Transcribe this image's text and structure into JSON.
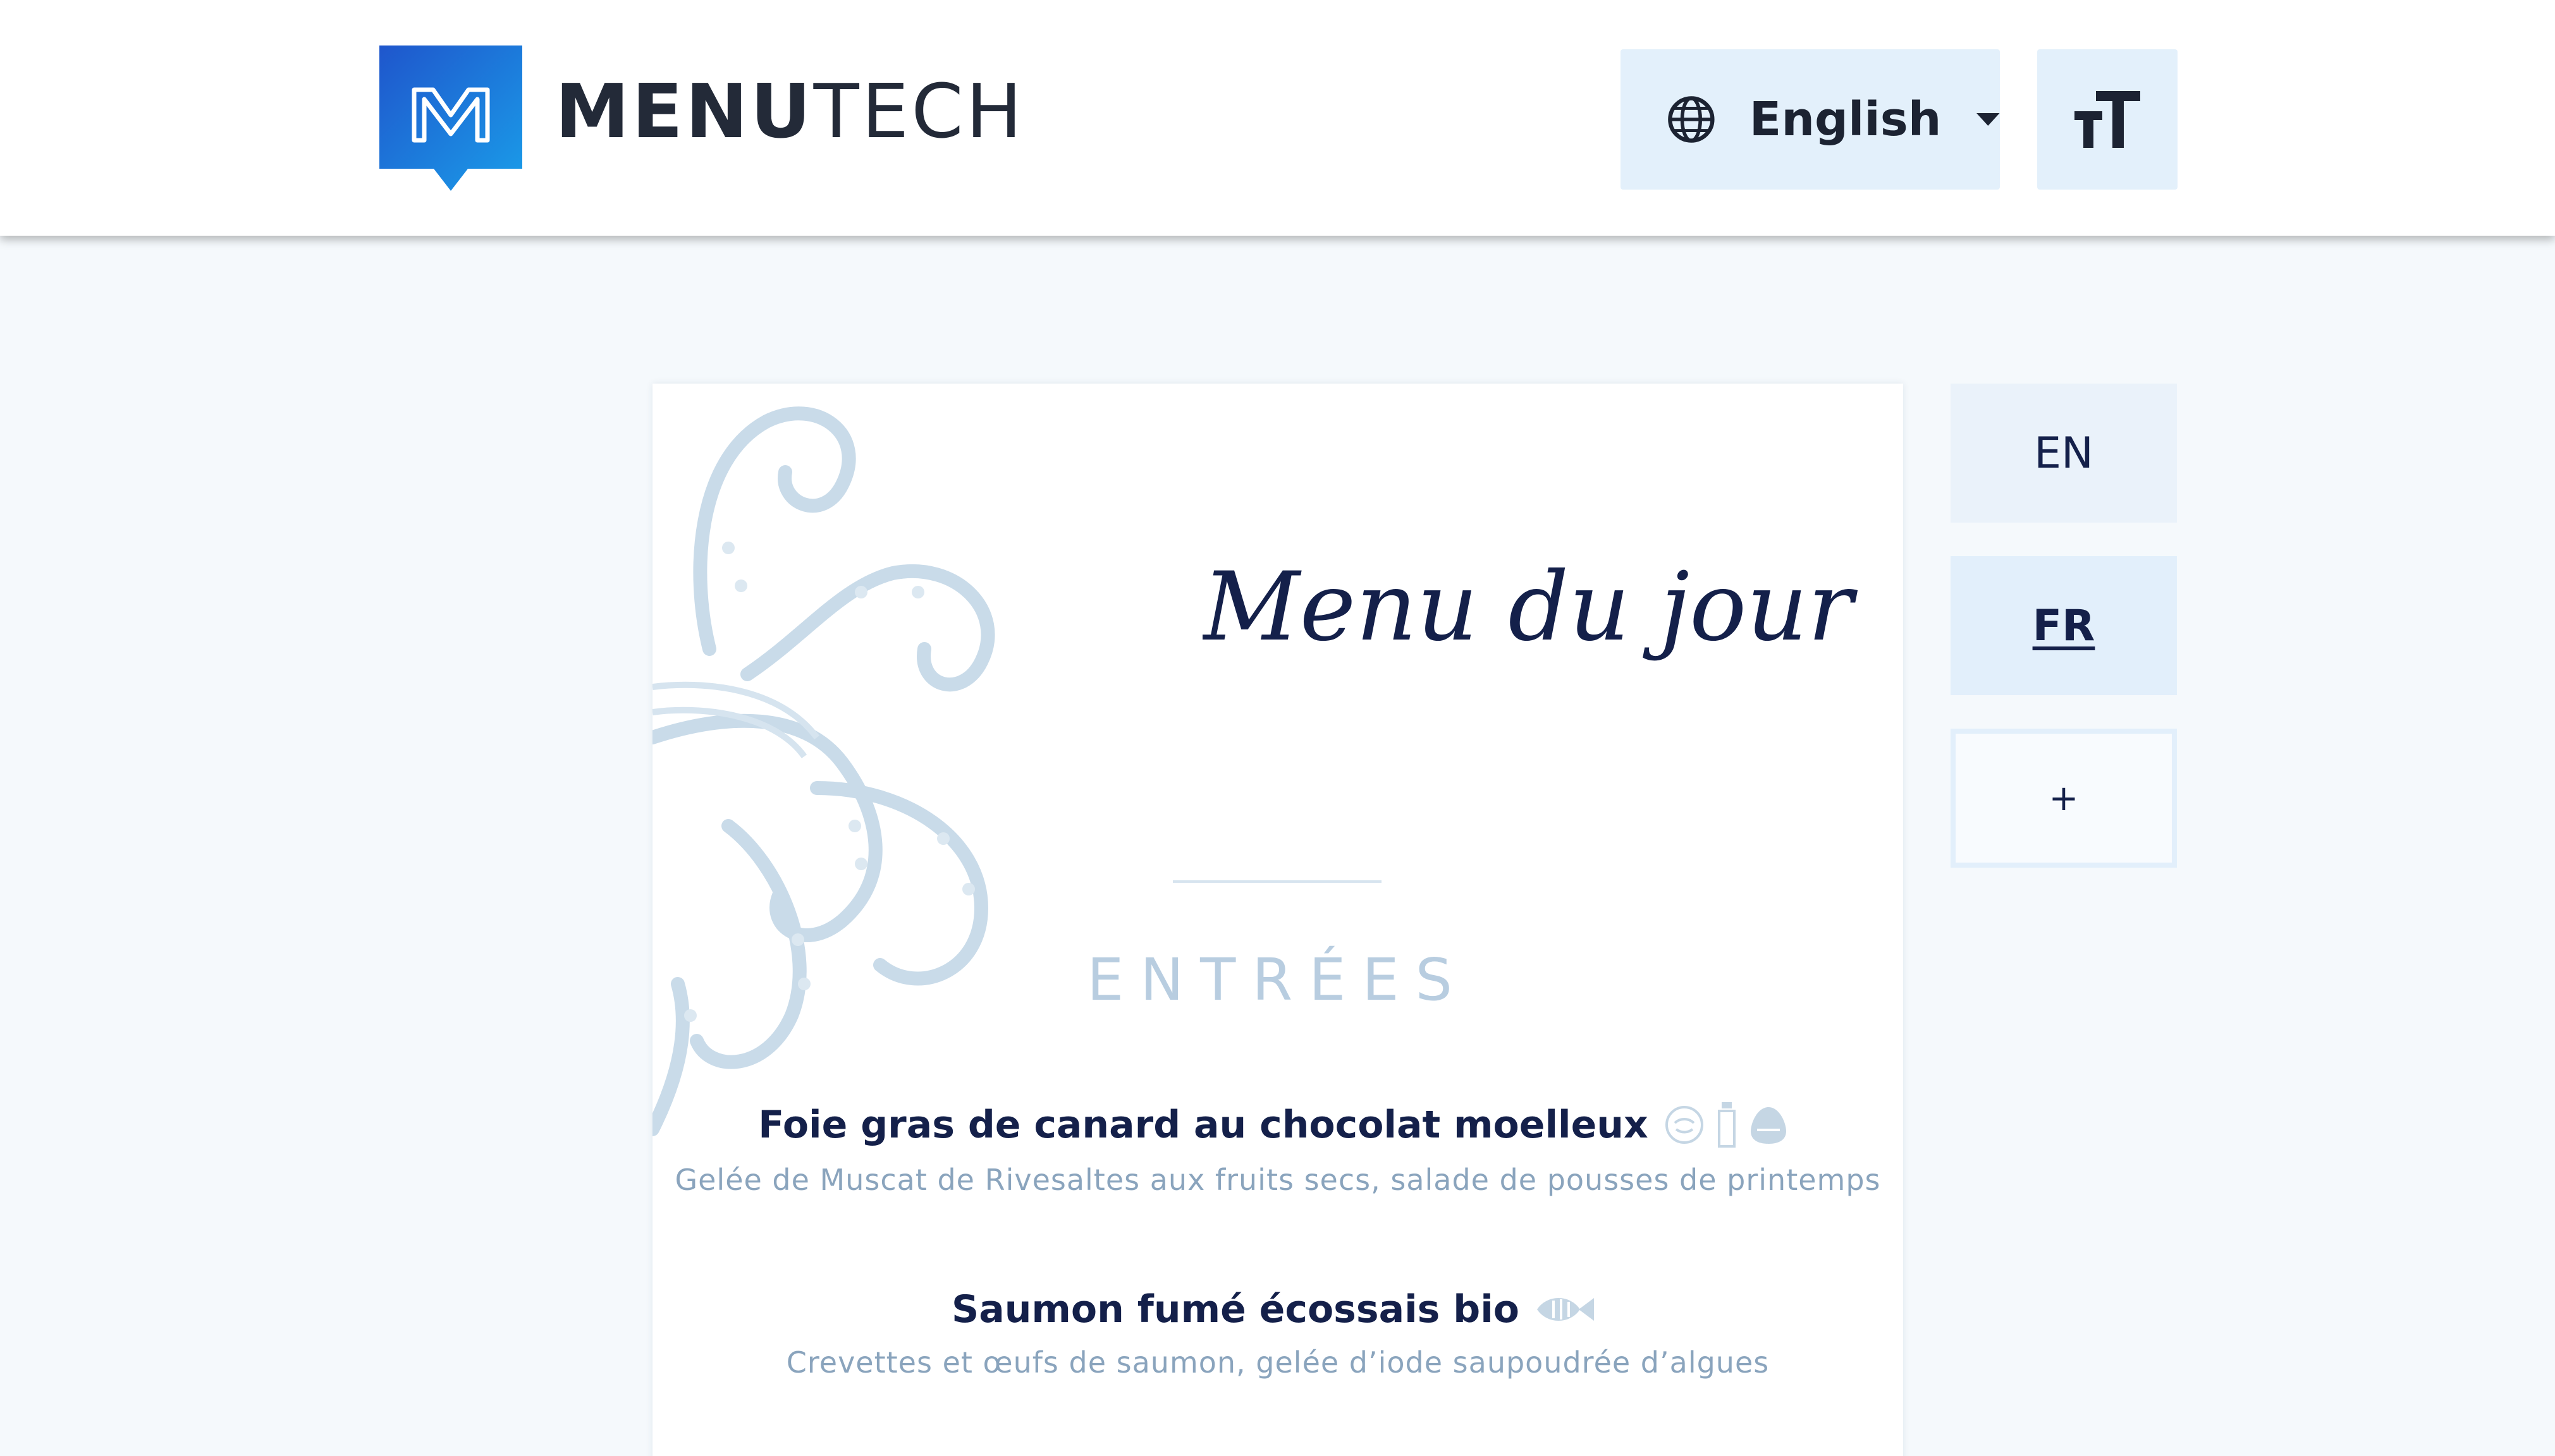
{
  "header": {
    "brand_bold": "MENU",
    "brand_light": "TECH",
    "logo_icon": "menutech-logo-icon",
    "language_select": {
      "value": "English",
      "icon": "globe-icon",
      "caret": "chevron-down-icon"
    },
    "text_size_icon": "text-size-icon"
  },
  "menu": {
    "title": "Menu du jour",
    "section": "ENTRÉES",
    "dishes": [
      {
        "name": "Foie gras de canard au chocolat moelleux",
        "description": "Gelée de Muscat de Rivesaltes aux fruits secs, salade de pousses de printemps",
        "allergen_icons": [
          "nuts-icon",
          "milk-bottle-icon",
          "egg-icon"
        ]
      },
      {
        "name": "Saumon fumé écossais bio",
        "description": "Crevettes et œufs de saumon, gelée d’iode saupoudrée d’algues",
        "allergen_icons": [
          "fish-icon"
        ]
      }
    ],
    "decoration": "octopus-illustration"
  },
  "language_tabs": {
    "items": [
      {
        "label": "EN",
        "active": false
      },
      {
        "label": "FR",
        "active": true
      }
    ],
    "add_label": "+"
  },
  "colors": {
    "brand_gradient_start": "#1f5fd0",
    "brand_gradient_end": "#1a9be8",
    "text_dark": "#14204a",
    "accent_light": "#e3f0fb",
    "muted": "#8aa4bd",
    "background": "#f5f9fc"
  }
}
